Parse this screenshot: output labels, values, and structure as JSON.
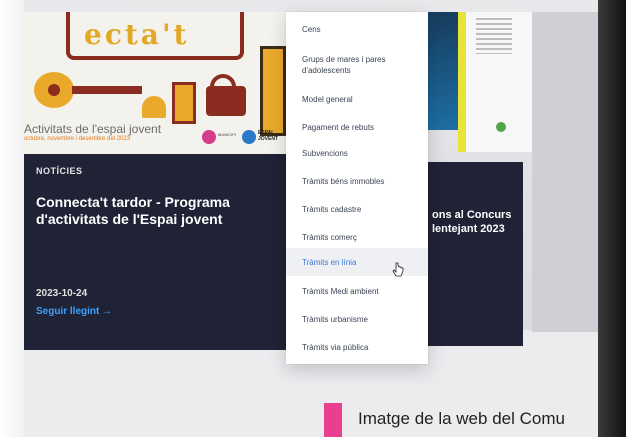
{
  "banner": {
    "title": "ecta't",
    "subtitle": "Activitats de l'espai jovent",
    "subtitle_small": "octubre, novembre i desembre del 2023",
    "logo_a_text": "MUNICIPI",
    "logo_b_text": "ESPAI JOVENT"
  },
  "news": {
    "kicker": "NOTÍCIES",
    "title": "Connecta't tardor - Programa d'activitats de l'Espai jovent",
    "date": "2023-10-24",
    "link": "Seguir llegint →"
  },
  "news_right": {
    "title_line1": "ons al Concurs",
    "title_line2": "lentejant 2023"
  },
  "menu": {
    "items": [
      {
        "label": "Cens"
      },
      {
        "label": "Grups de mares i pares d'adolescents"
      },
      {
        "label": "Model general"
      },
      {
        "label": "Pagament de rebuts"
      },
      {
        "label": "Subvencions"
      },
      {
        "label": "Tràmits béns immobles"
      },
      {
        "label": "Tràmits cadastre"
      },
      {
        "label": "Tràmits comerç"
      },
      {
        "label": "Tràmits en línia"
      },
      {
        "label": "Tràmits Medi ambient"
      },
      {
        "label": "Tràmits urbanisme"
      },
      {
        "label": "Tràmits via pública"
      }
    ],
    "active_index": 8
  },
  "caption": "Imatge de la web del Comu"
}
